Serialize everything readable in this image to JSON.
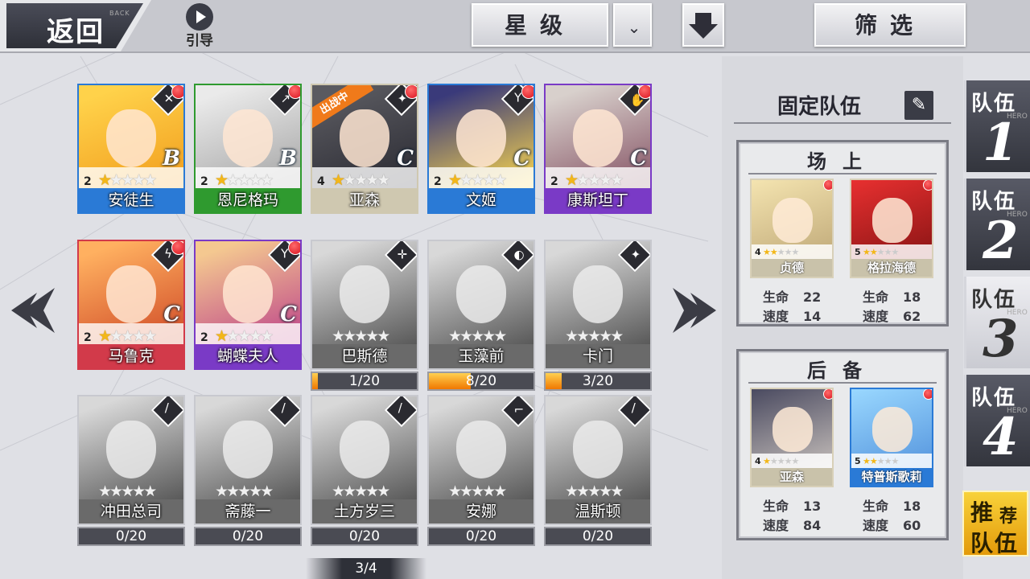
{
  "topbar": {
    "back_label": "返回",
    "back_sub": "BACK",
    "guide_label": "引导",
    "sort_label": "星级",
    "filter_label": "筛选"
  },
  "heroes": [
    {
      "name": "安徒生",
      "level": "2",
      "stars": 1,
      "grade": "B",
      "owned": true,
      "frame": "#2a7ad6",
      "art": [
        "#ffd24a",
        "#f2a020"
      ],
      "cls": "✕",
      "badge": true
    },
    {
      "name": "恩尼格玛",
      "level": "2",
      "stars": 1,
      "grade": "B",
      "owned": true,
      "frame": "#2f9a2f",
      "art": [
        "#eaeaea",
        "#a8a8a8"
      ],
      "cls": "↗",
      "badge": true
    },
    {
      "name": "亚森",
      "level": "4",
      "stars": 1,
      "grade": "C",
      "owned": true,
      "frame": "#cfc8b0",
      "art": [
        "#5a5a60",
        "#2c2c34"
      ],
      "cls": "✦",
      "badge": true,
      "in_battle": "出战中"
    },
    {
      "name": "文姬",
      "level": "2",
      "stars": 1,
      "grade": "C",
      "owned": true,
      "frame": "#2a7ad6",
      "art": [
        "#3a3a7a",
        "#f2d050"
      ],
      "cls": "Y",
      "badge": true
    },
    {
      "name": "康斯坦丁",
      "level": "2",
      "stars": 1,
      "grade": "C",
      "owned": true,
      "frame": "#7a3ac6",
      "art": [
        "#d8d0cc",
        "#8a5a6a"
      ],
      "cls": "✋",
      "badge": true
    },
    {
      "name": "马鲁克",
      "level": "2",
      "stars": 1,
      "grade": "C",
      "owned": true,
      "frame": "#d23a4a",
      "art": [
        "#ffb060",
        "#d2502a"
      ],
      "cls": "ϟ",
      "badge": true
    },
    {
      "name": "蝴蝶夫人",
      "level": "2",
      "stars": 1,
      "grade": "C",
      "owned": true,
      "frame": "#7a3ac6",
      "art": [
        "#f4c890",
        "#c04a8a"
      ],
      "cls": "Y",
      "badge": true
    },
    {
      "name": "巴斯德",
      "owned": false,
      "progress": "1/20",
      "fill": 0.05,
      "cls": "✛",
      "stars": 0
    },
    {
      "name": "玉藻前",
      "owned": false,
      "progress": "8/20",
      "fill": 0.4,
      "cls": "◐",
      "stars": 0
    },
    {
      "name": "卡门",
      "owned": false,
      "progress": "3/20",
      "fill": 0.15,
      "cls": "✦",
      "stars": 0
    },
    {
      "name": "冲田总司",
      "owned": false,
      "progress": "0/20",
      "fill": 0,
      "cls": "/",
      "stars": 0
    },
    {
      "name": "斋藤一",
      "owned": false,
      "progress": "0/20",
      "fill": 0,
      "cls": "/",
      "stars": 0
    },
    {
      "name": "土方岁三",
      "owned": false,
      "progress": "0/20",
      "fill": 0,
      "cls": "/",
      "stars": 0
    },
    {
      "name": "安娜",
      "owned": false,
      "progress": "0/20",
      "fill": 0,
      "cls": "⌐",
      "stars": 0
    },
    {
      "name": "温斯顿",
      "owned": false,
      "progress": "0/20",
      "fill": 0,
      "cls": "/",
      "stars": 0
    }
  ],
  "pager": "3/4",
  "fixed_team": {
    "title": "固定队伍",
    "field_title": "场上",
    "reserve_title": "后备",
    "hp_label": "生命",
    "speed_label": "速度",
    "field": [
      {
        "name": "贞德",
        "level": "4",
        "stars": 2,
        "hp": "22",
        "speed": "14",
        "art": [
          "#f4e4b0",
          "#b8a070"
        ],
        "frame": "#d8d0b8"
      },
      {
        "name": "格拉海德",
        "level": "5",
        "stars": 2,
        "hp": "18",
        "speed": "62",
        "art": [
          "#e83030",
          "#7a1010"
        ],
        "frame": "#d8d0b8"
      }
    ],
    "reserve": [
      {
        "name": "亚森",
        "level": "4",
        "stars": 1,
        "hp": "13",
        "speed": "84",
        "art": [
          "#4a4a60",
          "#d8d0c8"
        ],
        "frame": "#d8d0b8"
      },
      {
        "name": "特普斯歌莉",
        "level": "5",
        "stars": 2,
        "hp": "18",
        "speed": "60",
        "art": [
          "#9ad8ff",
          "#4a8ad8"
        ],
        "frame": "#2a7ad6"
      }
    ]
  },
  "team_tabs": [
    {
      "label": "队伍",
      "num": "1",
      "sub": "HERO"
    },
    {
      "label": "队伍",
      "num": "2",
      "sub": "HERO"
    },
    {
      "label": "队伍",
      "num": "3",
      "sub": "HERO",
      "active": true
    },
    {
      "label": "队伍",
      "num": "4",
      "sub": "HERO"
    }
  ],
  "recommend": {
    "c1": "推",
    "c2": "荐",
    "c3": "队伍"
  }
}
